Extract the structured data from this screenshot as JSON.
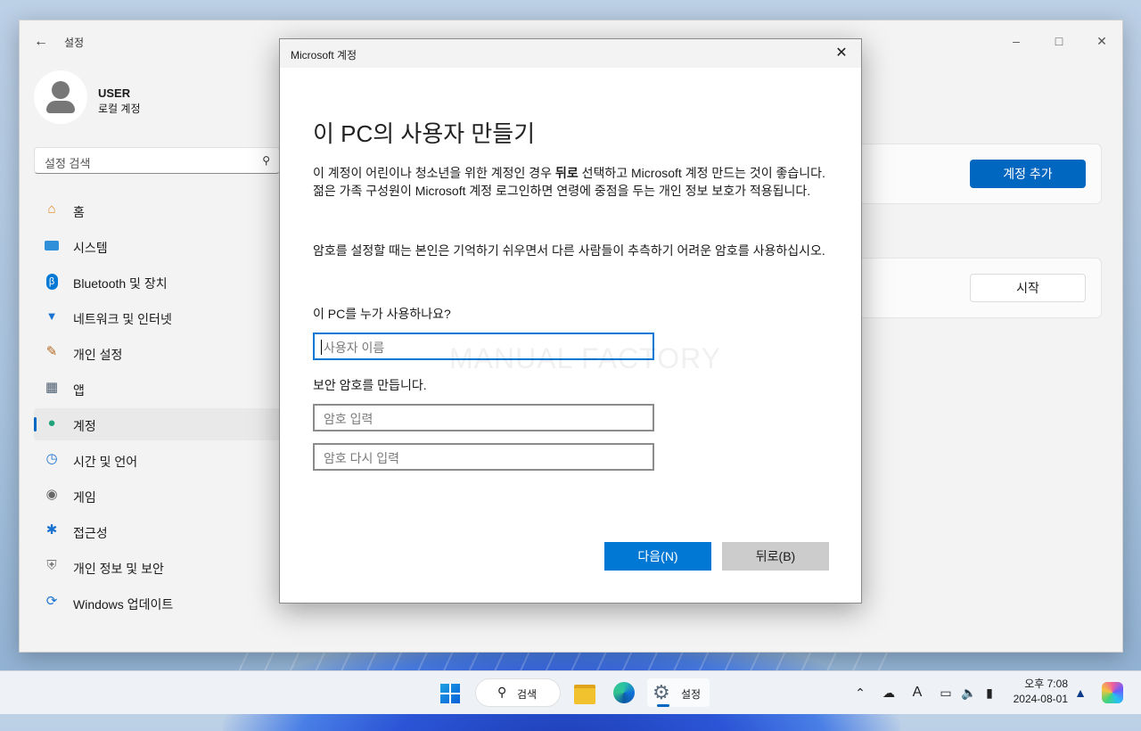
{
  "settings_window": {
    "title": "설정",
    "user": {
      "name": "USER",
      "type": "로컬 계정"
    },
    "search_placeholder": "설정 검색",
    "nav": [
      {
        "label": "홈",
        "icon": "home-icon"
      },
      {
        "label": "시스템",
        "icon": "system-icon"
      },
      {
        "label": "Bluetooth 및 장치",
        "icon": "bluetooth-icon"
      },
      {
        "label": "네트워크 및 인터넷",
        "icon": "wifi-icon"
      },
      {
        "label": "개인 설정",
        "icon": "brush-icon"
      },
      {
        "label": "앱",
        "icon": "apps-icon"
      },
      {
        "label": "계정",
        "icon": "account-icon",
        "active": true
      },
      {
        "label": "시간 및 언어",
        "icon": "globe-clock-icon"
      },
      {
        "label": "게임",
        "icon": "gamepad-icon"
      },
      {
        "label": "접근성",
        "icon": "accessibility-icon"
      },
      {
        "label": "개인 정보 및 보안",
        "icon": "shield-icon"
      },
      {
        "label": "Windows 업데이트",
        "icon": "update-icon"
      }
    ],
    "add_account_button": "계정 추가",
    "start_button": "시작"
  },
  "dialog": {
    "title": "Microsoft 계정",
    "heading": "이 PC의 사용자 만들기",
    "para1_pre": "이 계정이 어린이나 청소년을 위한 계정인 경우 ",
    "para1_bold": "뒤로",
    "para1_post": " 선택하고 Microsoft 계정 만드는 것이 좋습니다. 젊은 가족 구성원이 Microsoft 계정 로그인하면 연령에 중점을 두는 개인 정보 보호가 적용됩니다.",
    "para2": "암호를 설정할 때는 본인은 기억하기 쉬우면서 다른 사람들이 추측하기 어려운 암호를 사용하십시오.",
    "who_label": "이 PC를 누가 사용하나요?",
    "username_placeholder": "사용자 이름",
    "password_label": "보안 암호를 만듭니다.",
    "password_placeholder": "암호 입력",
    "password_confirm_placeholder": "암호 다시 입력",
    "watermark": "MANUAL FACTORY",
    "next_button": "다음(N)",
    "back_button": "뒤로(B)"
  },
  "taskbar": {
    "search_label": "검색",
    "settings_app_label": "설정",
    "time": "오후 7:08",
    "date": "2024-08-01",
    "tray_icons": [
      "chevron-up-icon",
      "cloud-off-icon",
      "ime-icon",
      "device-icon",
      "volume-icon",
      "battery-icon",
      "bell-icon",
      "copilot-icon"
    ],
    "ime_char": "A"
  },
  "colors": {
    "accent": "#0067c0",
    "dialog_primary": "#0078d4",
    "dialog_secondary": "#cccccc"
  }
}
